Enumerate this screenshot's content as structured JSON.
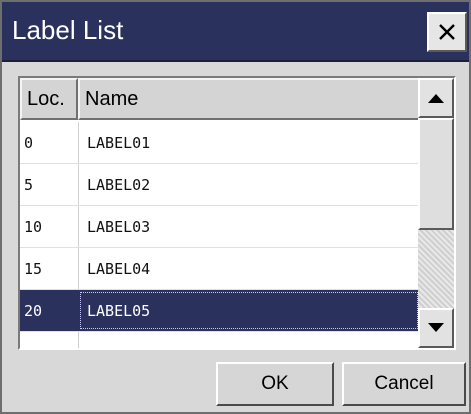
{
  "dialog": {
    "title": "Label List",
    "close_glyph": "✕",
    "ok_label": "OK",
    "cancel_label": "Cancel"
  },
  "table": {
    "columns": [
      "Loc.",
      "Name"
    ],
    "rows": [
      {
        "loc": "0",
        "name": "LABEL01",
        "selected": false
      },
      {
        "loc": "5",
        "name": "LABEL02",
        "selected": false
      },
      {
        "loc": "10",
        "name": "LABEL03",
        "selected": false
      },
      {
        "loc": "15",
        "name": "LABEL04",
        "selected": false
      },
      {
        "loc": "20",
        "name": "LABEL05",
        "selected": true
      }
    ]
  },
  "colors": {
    "titlebar": "#2a315d",
    "selection": "#2a315d",
    "dialog_bg": "#d8d8d8"
  },
  "icons": {
    "close": "close-icon",
    "scroll_up": "triangle-up-icon",
    "scroll_down": "triangle-down-icon"
  }
}
